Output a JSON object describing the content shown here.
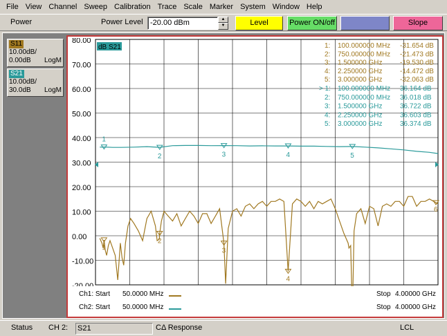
{
  "menu": [
    "File",
    "View",
    "Channel",
    "Sweep",
    "Calibration",
    "Trace",
    "Scale",
    "Marker",
    "System",
    "Window",
    "Help"
  ],
  "toolbar": {
    "menu_label": "Power",
    "power_level_label": "Power Level",
    "power_level_value": "-20.00 dBm",
    "softkeys": [
      {
        "label": "Level",
        "color": "#ffff00"
      },
      {
        "label": "Power ON/off",
        "color": "#66dd66"
      },
      {
        "label": "",
        "color": "#7e86c8"
      },
      {
        "label": "Slope",
        "color": "#ee6699"
      }
    ]
  },
  "traces": [
    {
      "name": "S11",
      "scale": "10.00dB/",
      "ref": "0.00dB",
      "format": "LogM",
      "color": "#a07820"
    },
    {
      "name": "S21",
      "scale": "10.00dB/",
      "ref": "30.0dB",
      "format": "LogM",
      "color": "#2a9a9a"
    }
  ],
  "active_trace_label": "dB S21",
  "chart_data": {
    "type": "line",
    "ylim": [
      -20,
      80
    ],
    "yticks": [
      "80.00",
      "70.00",
      "60.00",
      "50.00",
      "40.00",
      "30.00",
      "20.00",
      "10.00",
      "0.00",
      "-10.00",
      "-20.00"
    ],
    "series": [
      {
        "name": "Ch1",
        "color": "#a07820",
        "x": [
          50,
          75,
          90,
          100,
          115,
          130,
          150,
          170,
          200,
          230,
          260,
          290,
          310,
          330,
          350,
          380,
          410,
          450,
          500,
          550,
          600,
          650,
          700,
          720,
          745,
          750,
          770,
          800,
          850,
          900,
          950,
          1000,
          1050,
          1100,
          1150,
          1200,
          1250,
          1300,
          1350,
          1400,
          1450,
          1500,
          1520,
          1550,
          1600,
          1650,
          1700,
          1750,
          1800,
          1850,
          1900,
          1950,
          2000,
          2050,
          2100,
          2150,
          2200,
          2250,
          2300,
          2350,
          2400,
          2450,
          2500,
          2550,
          2600,
          2650,
          2700,
          2750,
          2800,
          2850,
          2900,
          2950,
          2960,
          2980,
          3000,
          3020,
          3050,
          3100,
          3150,
          3200,
          3250,
          3300,
          3350,
          3400,
          3450,
          3500,
          3550,
          3600,
          3650,
          3700,
          3750,
          3800,
          3850,
          3900,
          3950,
          4000
        ],
        "y": [
          -1,
          -3,
          -5,
          -1.654,
          -6,
          -8,
          -4,
          -2,
          -5,
          -8,
          -18,
          -3,
          -9,
          -12,
          -3,
          4,
          7,
          5,
          2,
          -2,
          7,
          10,
          4,
          -2,
          -1.473,
          1,
          6,
          10,
          8,
          6,
          9,
          4,
          7,
          10,
          8,
          5,
          9,
          9,
          5,
          8,
          11,
          -3,
          -19.53,
          3,
          10,
          11,
          8,
          12,
          13,
          11,
          13,
          14,
          12,
          14,
          14,
          15,
          14,
          -14.472,
          13,
          15,
          14,
          12,
          14,
          11,
          14,
          13,
          14,
          15,
          11,
          6,
          1,
          -3,
          -5,
          -4,
          -32.063,
          2,
          9,
          11,
          5,
          12,
          11,
          4,
          12,
          13,
          12,
          14,
          14,
          12,
          16,
          16,
          12,
          14,
          14,
          15,
          14,
          13
        ]
      },
      {
        "name": "Ch2",
        "color": "#2a9a9a",
        "x": [
          50,
          100,
          200,
          300,
          450,
          600,
          750,
          900,
          1050,
          1200,
          1350,
          1500,
          1650,
          1800,
          1950,
          2100,
          2250,
          2400,
          2550,
          2700,
          2850,
          3000,
          3150,
          3300,
          3450,
          3600,
          3750,
          3900,
          4000
        ],
        "y": [
          36.1,
          36.164,
          36.0,
          36.0,
          36.1,
          36.3,
          36.018,
          36.7,
          36.8,
          36.8,
          36.7,
          36.722,
          36.7,
          36.6,
          36.65,
          36.6,
          36.603,
          36.5,
          36.5,
          36.4,
          36.3,
          36.374,
          36.1,
          35.8,
          35.4,
          35.0,
          34.4,
          34.0,
          33.5
        ]
      }
    ],
    "markers": [
      {
        "id": "1",
        "freq": "100.000000 MHz",
        "ch1": "-31.654 dB",
        "ch2": "36.164 dB"
      },
      {
        "id": "2",
        "freq": "750.000000 MHz",
        "ch1": "-21.473 dB",
        "ch2": "36.018 dB"
      },
      {
        "id": "3",
        "freq": "1.500000 GHz",
        "ch1": "-19.530 dB",
        "ch2": "36.722 dB"
      },
      {
        "id": "4",
        "freq": "2.250000 GHz",
        "ch1": "-14.472 dB",
        "ch2": "36.603 dB"
      },
      {
        "id": "5",
        "freq": "3.000000 GHz",
        "ch1": "-32.063 dB",
        "ch2": "36.374 dB"
      }
    ],
    "extra_marker_label": "6"
  },
  "footer": {
    "ch1": {
      "start_label": "Ch1: Start",
      "start": "50.0000 MHz",
      "stop_label": "Stop",
      "stop": "4.00000 GHz"
    },
    "ch2": {
      "start_label": "Ch2: Start",
      "start": "50.0000 MHz",
      "stop_label": "Stop",
      "stop": "4.00000 GHz"
    }
  },
  "status": {
    "label": "Status",
    "channel": "CH 2:",
    "param": "S21",
    "response": "CΔ Response",
    "lcl": "LCL"
  }
}
